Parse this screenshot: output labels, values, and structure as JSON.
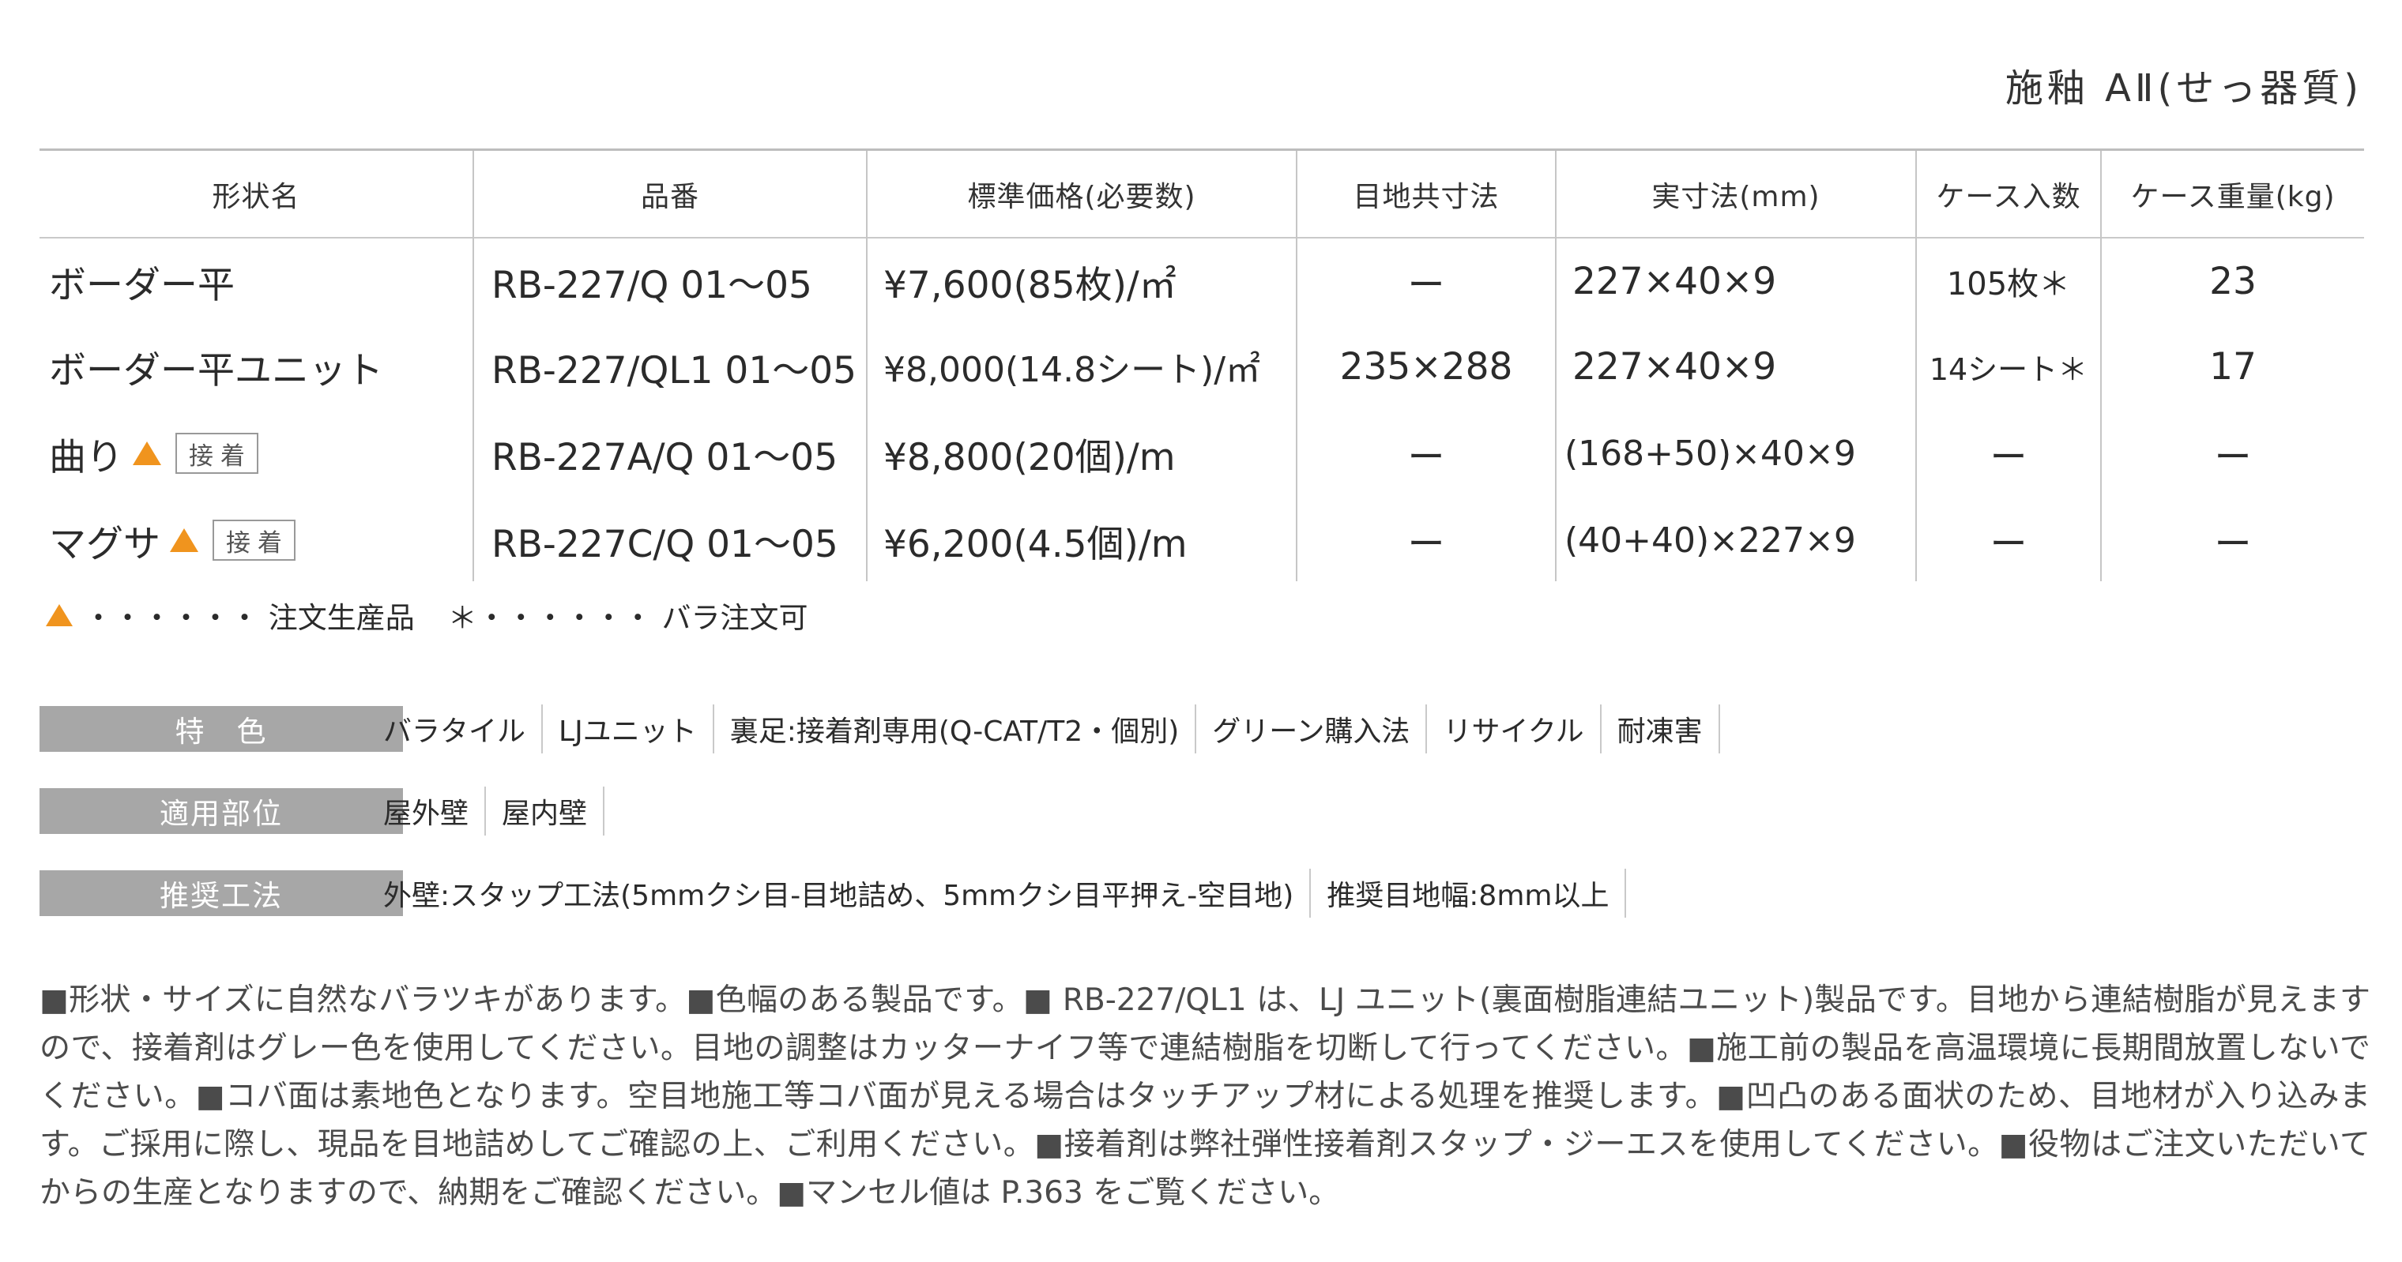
{
  "header": {
    "title": "施釉 AⅡ(せっ器質)"
  },
  "table": {
    "columns": [
      "形状名",
      "品番",
      "標準価格(必要数)",
      "目地共寸法",
      "実寸法(mm)",
      "ケース入数",
      "ケース重量(kg)"
    ],
    "rows": [
      {
        "name": "ボーダー平",
        "marker": "",
        "badge": "",
        "code": "RB-227/Q 01〜05",
        "price": "¥7,600(85枚)/㎡",
        "joint": "ー",
        "size": "227×40×9",
        "case_qty": "105枚＊",
        "weight": "23"
      },
      {
        "name": "ボーダー平ユニット",
        "marker": "",
        "badge": "",
        "code": "RB-227/QL1 01〜05",
        "price": "¥8,000(14.8シート)/㎡",
        "joint": "235×288",
        "size": "227×40×9",
        "case_qty": "14シート＊",
        "weight": "17"
      },
      {
        "name": "曲り",
        "marker": "▲",
        "badge": "接着",
        "code": "RB-227A/Q 01〜05",
        "price": "¥8,800(20個)/m",
        "joint": "ー",
        "size": "(168+50)×40×9",
        "case_qty": "ー",
        "weight": "ー"
      },
      {
        "name": "マグサ",
        "marker": "▲",
        "badge": "接着",
        "code": "RB-227C/Q 01〜05",
        "price": "¥6,200(4.5個)/m",
        "joint": "ー",
        "size": "(40+40)×227×9",
        "case_qty": "ー",
        "weight": "ー"
      }
    ]
  },
  "legend": {
    "order_label": "・・・・・・ 注文生産品",
    "loose_symbol": "＊",
    "loose_label": "・・・・・・ バラ注文可"
  },
  "features": [
    {
      "label": "特　色",
      "items": [
        "バラタイル",
        "LJユニット",
        "裏足:接着剤専用(Q-CAT/T2・個別)",
        "グリーン購入法",
        "リサイクル",
        "耐凍害"
      ]
    },
    {
      "label": "適用部位",
      "items": [
        "屋外壁",
        "屋内壁"
      ]
    },
    {
      "label": "推奨工法",
      "items": [
        "外壁:スタップ工法(5mmクシ目-目地詰め、5mmクシ目平押え-空目地)",
        "推奨目地幅:8mm以上"
      ]
    }
  ],
  "notes": "■形状・サイズに自然なバラツキがあります。■色幅のある製品です。■ RB-227/QL1 は、LJ ユニット(裏面樹脂連結ユニット)製品です。目地から連結樹脂が見えますので、接着剤はグレー色を使用してください。目地の調整はカッターナイフ等で連結樹脂を切断して行ってください。■施工前の製品を高温環境に長期間放置しないでください。■コバ面は素地色となります。空目地施工等コバ面が見える場合はタッチアップ材による処理を推奨します。■凹凸のある面状のため、目地材が入り込みます。ご採用に際し、現品を目地詰めしてご確認の上、ご利用ください。■接着剤は弊社弾性接着剤スタップ・ジーエスを使用してください。■役物はご注文いただいてからの生産となりますので、納期をご確認ください。■マンセル値は P.363 をご覧ください。",
  "colors": {
    "triangle_marker": "#f0941e",
    "label_bg": "#a7a7a7",
    "rule": "#c6c6c6"
  }
}
